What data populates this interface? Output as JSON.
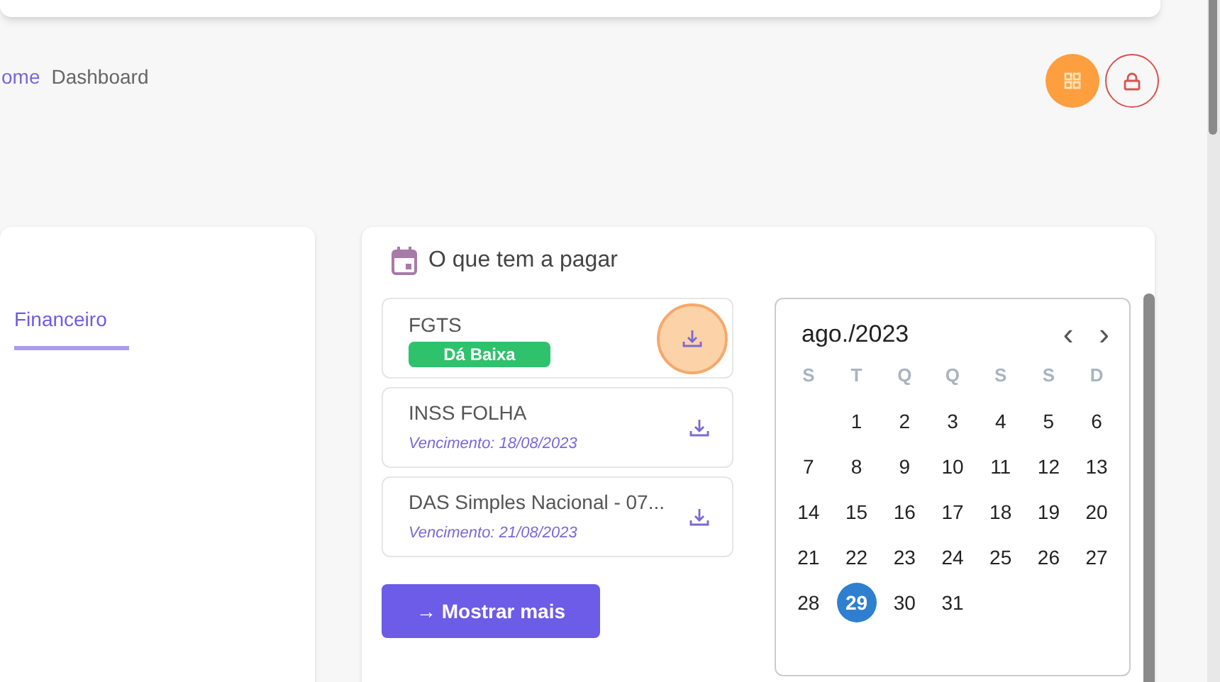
{
  "breadcrumb": [
    {
      "label": "ome",
      "kind": "link"
    },
    {
      "label": "Dashboard",
      "kind": "current"
    }
  ],
  "actions": [
    {
      "kind": "grid"
    },
    {
      "kind": "lock"
    }
  ],
  "left_panel": {
    "tabs": [
      {
        "label": "Financeiro",
        "selected": true
      }
    ]
  },
  "payments": {
    "title": "O que tem a pagar",
    "items": [
      {
        "name": "FGTS",
        "badge": "Dá Baixa",
        "highlighted": true
      },
      {
        "name": "INSS FOLHA",
        "due": "Vencimento: 18/08/2023",
        "highlighted": false
      },
      {
        "name": "DAS Simples Nacional - 07...",
        "due": "Vencimento: 21/08/2023",
        "highlighted": false
      }
    ],
    "more_button": "→ Mostrar mais"
  },
  "calendar": {
    "month": "ago./2023",
    "prev": "‹",
    "next": "›",
    "weekdays": [
      "S",
      "T",
      "Q",
      "Q",
      "S",
      "S",
      "D"
    ],
    "weeks": [
      [
        {
          "day": "1",
          "selected": false
        },
        {
          "day": "2",
          "selected": false
        },
        {
          "day": "3",
          "selected": false
        },
        {
          "day": "4",
          "selected": false
        },
        {
          "day": "5",
          "selected": false
        },
        {
          "day": "6",
          "selected": false
        }
      ],
      [
        {
          "day": "7",
          "selected": false
        },
        {
          "day": "8",
          "selected": false
        },
        {
          "day": "9",
          "selected": false
        },
        {
          "day": "10",
          "selected": false
        },
        {
          "day": "11",
          "selected": false
        },
        {
          "day": "12",
          "selected": false
        },
        {
          "day": "13",
          "selected": false
        }
      ],
      [
        {
          "day": "14",
          "selected": false
        },
        {
          "day": "15",
          "selected": false
        },
        {
          "day": "16",
          "selected": false
        },
        {
          "day": "17",
          "selected": false
        },
        {
          "day": "18",
          "selected": false
        },
        {
          "day": "19",
          "selected": false
        },
        {
          "day": "20",
          "selected": false
        }
      ],
      [
        {
          "day": "21",
          "selected": false
        },
        {
          "day": "22",
          "selected": false
        },
        {
          "day": "23",
          "selected": false
        },
        {
          "day": "24",
          "selected": false
        },
        {
          "day": "25",
          "selected": false
        },
        {
          "day": "26",
          "selected": false
        },
        {
          "day": "27",
          "selected": false
        }
      ],
      [
        {
          "day": "28",
          "selected": false
        },
        {
          "day": "29",
          "selected": true
        },
        {
          "day": "30",
          "selected": false
        },
        {
          "day": "31",
          "selected": false
        }
      ]
    ]
  }
}
